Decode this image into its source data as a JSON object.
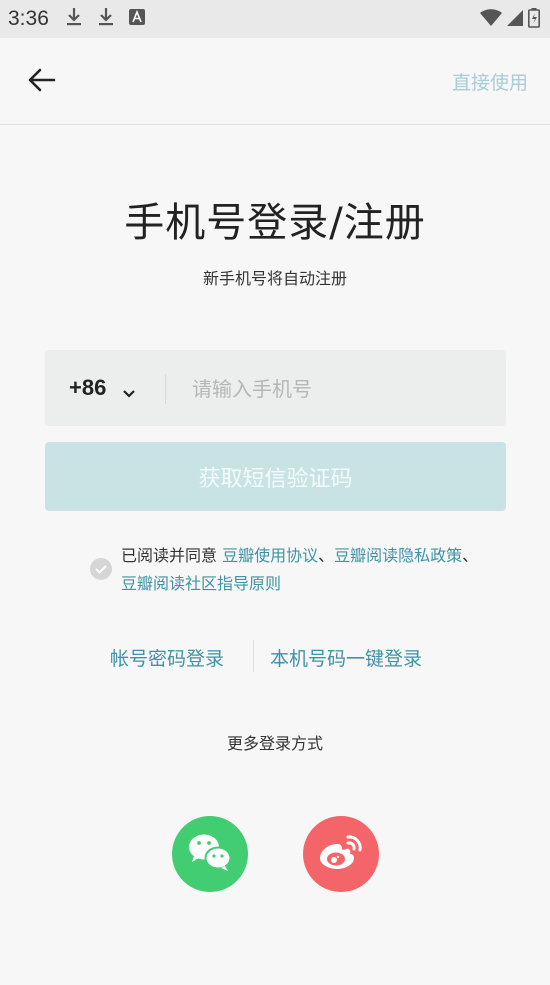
{
  "status_bar": {
    "time": "3:36"
  },
  "app_bar": {
    "skip_label": "直接使用"
  },
  "header": {
    "title": "手机号登录/注册",
    "subtitle": "新手机号将自动注册"
  },
  "phone_form": {
    "country_code": "+86",
    "phone_placeholder": "请输入手机号",
    "phone_value": "",
    "sms_button_label": "获取短信验证码"
  },
  "agreement": {
    "prefix": "已阅读并同意 ",
    "link1": "豆瓣使用协议",
    "sep1": "、",
    "link2": "豆瓣阅读隐私政策",
    "sep2": "、",
    "link3": "豆瓣阅读社区指导原则"
  },
  "alt_login": {
    "password_login": "帐号密码登录",
    "one_tap_login": "本机号码一键登录"
  },
  "more_login": {
    "label": "更多登录方式",
    "options": [
      {
        "icon": "wechat-icon",
        "color": "#42cd73"
      },
      {
        "icon": "weibo-icon",
        "color": "#f4656a"
      }
    ]
  },
  "colors": {
    "accent": "#3f93a4",
    "button_disabled": "#c9e3e5",
    "skip_text": "#a9cdd4"
  }
}
